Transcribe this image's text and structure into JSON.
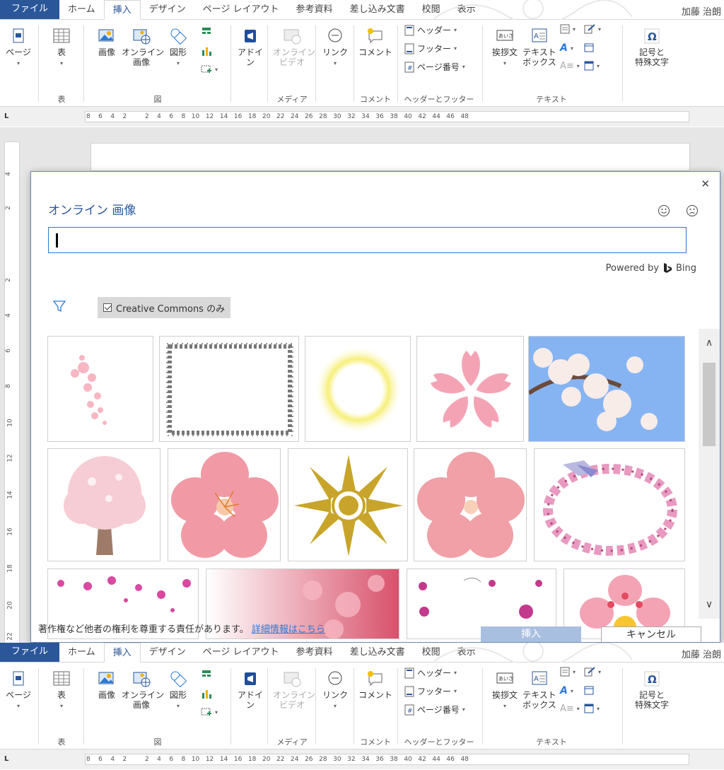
{
  "ribbon": {
    "tabs": [
      "ファイル",
      "ホーム",
      "挿入",
      "デザイン",
      "ページ レイアウト",
      "参考資料",
      "差し込み文書",
      "校閲",
      "表示"
    ],
    "user": "加藤 治朗",
    "user_short": "加藤 治朗",
    "page_label": "ページ",
    "table_label": "表",
    "picture_label": "画像",
    "online_picture_label": "オンライン\n画像",
    "shapes_label": "図形",
    "addin_label": "アドイ\nン",
    "online_video_label": "オンライン\nビデオ",
    "link_label": "リンク",
    "comment_label": "コメント",
    "header_label": "ヘッダー",
    "footer_label": "フッター",
    "pagenum_label": "ページ番号",
    "greeting_label": "挨拶文",
    "textbox_label": "テキスト\nボックス",
    "symbol_label": "記号と\n特殊文字",
    "group_table": "表",
    "group_illust": "図",
    "group_media": "メディア",
    "group_comment": "コメント",
    "group_hf": "ヘッダーとフッター",
    "group_text": "テキスト",
    "ruler_numbers": "8    6    4    2         2    4    6    8   10   12   14   16   18   20   22   24   26   28   30   32   34   36   38   40   42   44   46   48"
  },
  "vruler": [
    "4",
    "2",
    "",
    "2",
    "4",
    "6",
    "8",
    "10",
    "12",
    "14",
    "16",
    "18",
    "20",
    "22"
  ],
  "dialog": {
    "title": "オンライン 画像",
    "search_placeholder": "",
    "powered_by": "Powered by",
    "bing": "Bing",
    "cc_label": "Creative Commons のみ",
    "footer_text": "著作権など他者の権利を尊重する責任があります。",
    "footer_link": "詳細情報はこちら",
    "insert": "挿入",
    "cancel": "キャンセル"
  },
  "colors": {
    "accent": "#2b579a",
    "link": "#2b79d6",
    "sakura_pink": "#f4a3b5"
  }
}
